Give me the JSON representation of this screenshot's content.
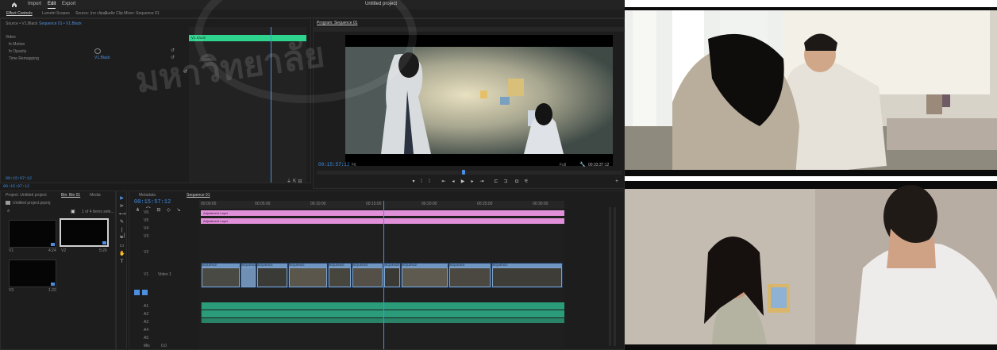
{
  "menubar": {
    "home_icon": "home-icon",
    "tabs": [
      "Import",
      "Edit",
      "Export"
    ],
    "active_tab": "Edit",
    "project_title": "Untitled project"
  },
  "workspace": {
    "items": [
      "Effect Controls",
      "Lumetri Scopes",
      "Source: (no clips)",
      "Audio Clip Mixer: Sequence 01"
    ],
    "selected": "Effect Controls"
  },
  "source_panel": {
    "header_left": "Source • V1.Black",
    "header_right": "Sequence 01 • V1.Black",
    "rows": [
      "Video",
      "fx Motion",
      "fx Opacity",
      "Time Remapping"
    ],
    "mini_clip_label": "V1.Black",
    "motion_value": "V1.Black",
    "timecode": "00:15:07:12"
  },
  "program_monitor": {
    "title": "Program: Sequence 01",
    "timecode_left": "00:15:57:12",
    "fit_label": "Fit",
    "quality_label": "Full",
    "timecode_right": "00:33:37:12",
    "transport": [
      "mark-in",
      "mark-out",
      "go-in",
      "step-back",
      "play",
      "step-forward",
      "go-out",
      "insert",
      "overwrite",
      "export-frame",
      "settings",
      "add"
    ]
  },
  "project_panel": {
    "tabs": [
      "Project: Untitled project",
      "Bin: Bin 01",
      "Media",
      "Libraries"
    ],
    "active_tab": "Bin: Bin 01",
    "file_name": "Untitled project.prproj",
    "item_count": "1 of 4 items sele...",
    "thumbnails": [
      {
        "label": "V1",
        "duration": "4:24"
      },
      {
        "label": "V2",
        "duration": "5:26"
      },
      {
        "label": "V3",
        "duration": "1:20"
      }
    ]
  },
  "timeline": {
    "tabs": [
      "Metadata",
      "Sequence 01"
    ],
    "active_tab": "Sequence 01",
    "timecode": "00:15:57:12",
    "ruler_ticks": [
      "00:00:00",
      "00:05:00",
      "00:10:00",
      "00:15:00",
      "00:20:00",
      "00:25:00",
      "00:30:00"
    ],
    "track_labels": [
      "V6",
      "V5",
      "V4",
      "V3",
      "V2",
      "V1",
      "A1",
      "A2",
      "A3",
      "A4",
      "A5",
      "Mix"
    ],
    "pink_clips": [
      "Adjustment Layer",
      "Adjustment Layer"
    ],
    "video_clips": [
      "SEQUENCE",
      "SEQUENCE",
      "SEQUENCE",
      "SEQUENCE",
      "SEQUENCE",
      "SEQUENCE",
      "SEQUENCE",
      "SEQUENCE",
      "SEQUENCE",
      "SEQUENCE"
    ],
    "video_track_name": "Video 1",
    "mix_label": "Mix",
    "mix_value": "0.0"
  },
  "watermark": {
    "text": "มหาวิทยาลัย"
  },
  "colors": {
    "app_bg": "#1b1b1b",
    "accent_blue": "#4c8ee0",
    "clip_pink": "#e08fd9",
    "clip_video": "#7fa2c9",
    "clip_audio": "#2b9c79",
    "selected_green": "#2ed38d"
  }
}
